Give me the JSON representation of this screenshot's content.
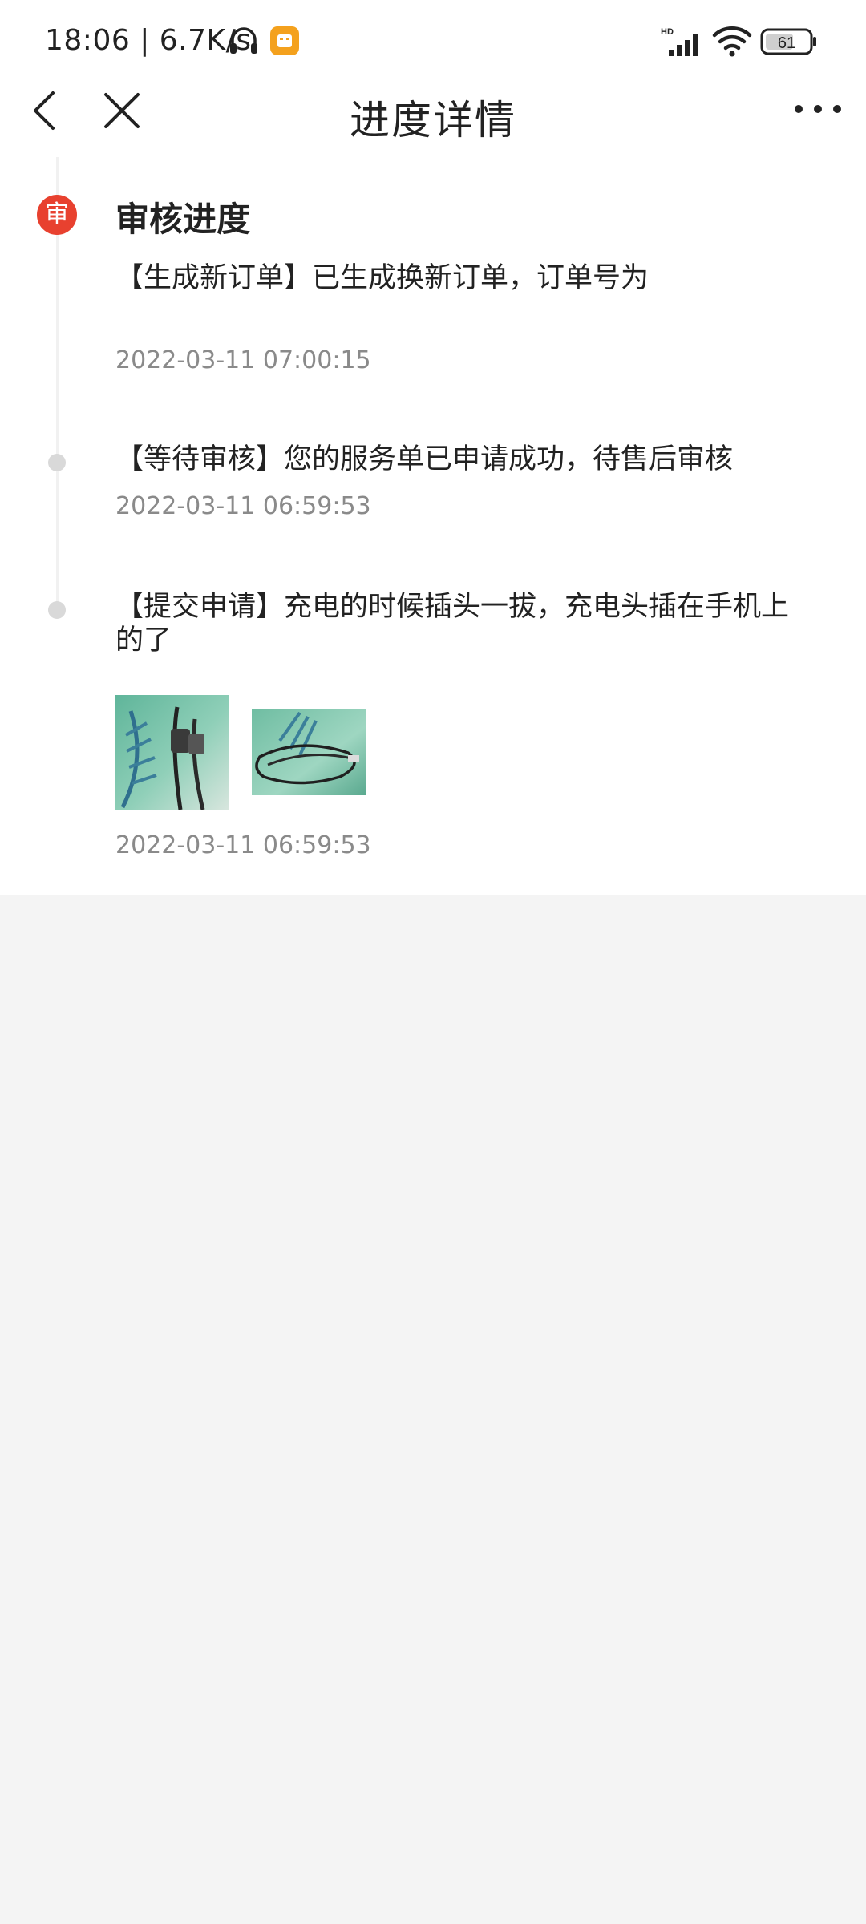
{
  "status_bar": {
    "time": "18:06 | 6.7K/s",
    "battery": "61",
    "network_label": "HD"
  },
  "nav": {
    "title": "进度详情"
  },
  "progress": {
    "section_title": "审核进度",
    "badge_text": "审",
    "entries": [
      {
        "text": "【生成新订单】已生成换新订单，订单号为",
        "time": "2022-03-11 07:00:15"
      },
      {
        "text": "【等待审核】您的服务单已申请成功，待售后审核",
        "time": "2022-03-11 06:59:53"
      },
      {
        "text": "【提交申请】充电的时候插头一拔，充电头插在手机上的了",
        "time": "2022-03-11 06:59:53"
      }
    ]
  },
  "colors": {
    "accent_red": "#e8412f",
    "notification_orange": "#f4a11d",
    "timestamp_gray": "#8a8a8a",
    "background_gray": "#f4f4f4"
  }
}
